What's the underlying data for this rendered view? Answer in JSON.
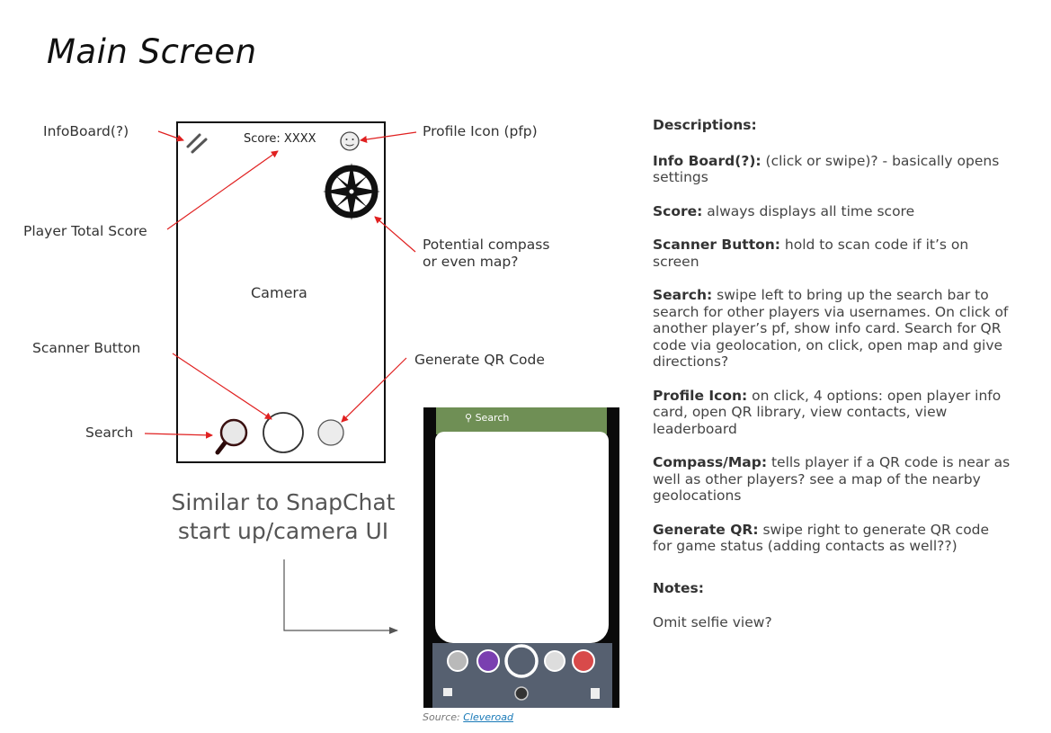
{
  "title": "Main Screen",
  "mockup": {
    "score": "Score: XXXX",
    "camera": "Camera"
  },
  "labels": {
    "infoboard": "InfoBoard(?)",
    "player_total_score": "Player Total Score",
    "scanner_button": "Scanner Button",
    "search": "Search",
    "profile_icon": "Profile Icon (pfp)",
    "compass_line1": "Potential compass",
    "compass_line2": "or even map?",
    "generate_qr": "Generate QR Code"
  },
  "similar": {
    "line1": "Similar to SnapChat",
    "line2": "start up/camera UI"
  },
  "snapchat": {
    "search": "Search"
  },
  "source": {
    "prefix": "Source: ",
    "link": "Cleveroad"
  },
  "descriptions": {
    "heading": "Descriptions:",
    "items": [
      {
        "term": "Info Board(?):",
        "text": " (click or swipe)? - basically opens settings"
      },
      {
        "term": "Score:",
        "text": " always displays all time score"
      },
      {
        "term": "Scanner Button:",
        "text": " hold to scan code if it’s on screen"
      },
      {
        "term": "Search:",
        "text": " swipe left to bring up the search bar to search for other players via usernames. On click of another player’s pf, show info card. Search for QR code via geolocation, on click, open map and give directions?"
      },
      {
        "term": "Profile Icon:",
        "text": " on click, 4 options: open player info card, open QR library, view contacts, view leaderboard"
      },
      {
        "term": "Compass/Map:",
        "text": " tells player if a QR code is near as well as other players? see a map of the nearby geolocations"
      },
      {
        "term": "Generate QR:",
        "text": " swipe right to generate QR code for game status (adding contacts as well??)"
      }
    ]
  },
  "notes": {
    "heading": "Notes:",
    "text": "Omit selfie view?"
  },
  "colors": {
    "arrow": "#e02020",
    "frame": "#111111",
    "link": "#1a7ab8"
  }
}
